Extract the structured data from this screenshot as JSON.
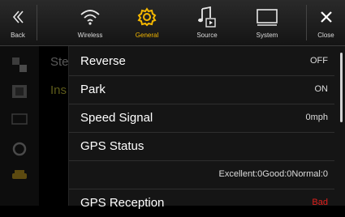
{
  "topbar": {
    "back_label": "Back",
    "tabs": [
      {
        "label": "Wireless",
        "icon": "wifi-icon"
      },
      {
        "label": "General",
        "icon": "gear-icon",
        "active": true
      },
      {
        "label": "Source",
        "icon": "music-note-icon"
      },
      {
        "label": "System",
        "icon": "monitor-icon"
      }
    ],
    "close_label": "Close",
    "accent_color": "#f5b800"
  },
  "behind_list": {
    "item1": "Ste",
    "item2": "Ins"
  },
  "settings": {
    "rows": [
      {
        "name": "Reverse",
        "value": "OFF"
      },
      {
        "name": "Park",
        "value": "ON"
      },
      {
        "name": "Speed Signal",
        "value": "0mph"
      },
      {
        "name": "GPS Status",
        "value": ""
      },
      {
        "name": "",
        "value": "Excellent:0Good:0Normal:0"
      },
      {
        "name": "GPS Reception",
        "value": "Bad"
      }
    ],
    "bad_color": "#e0201c"
  }
}
